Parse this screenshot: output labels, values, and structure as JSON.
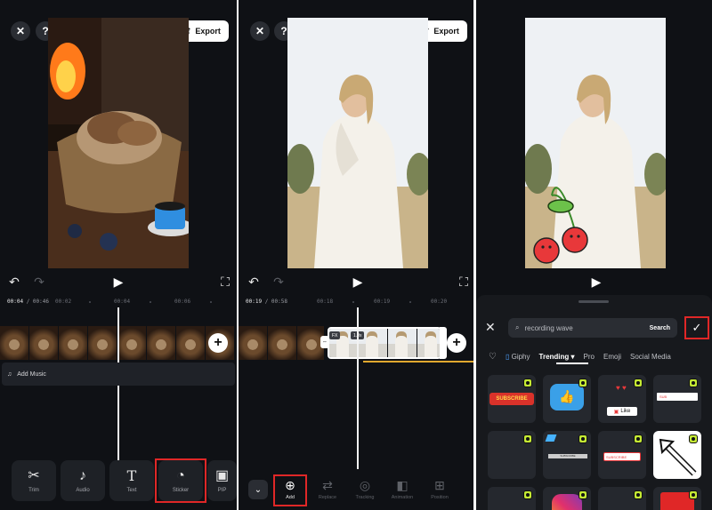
{
  "panel1": {
    "export_label": "Export",
    "time_current": "00:04",
    "time_total": "/ 00:46",
    "ticks": [
      "00:02",
      "00:04",
      "00:06"
    ],
    "music_label": "Add Music",
    "tools": [
      "Trim",
      "Audio",
      "Text",
      "Sticker",
      "PIP"
    ]
  },
  "panel2": {
    "export_label": "Export",
    "time_current": "00:19",
    "time_total": "/ 00:58",
    "ticks": [
      "00:18",
      "00:19",
      "00:20"
    ],
    "clip_tags": [
      "FX",
      "1.0x"
    ],
    "tools": [
      "Add",
      "Replace",
      "Tracking",
      "Animation",
      "Position"
    ]
  },
  "panel3": {
    "search_value": "recording wave",
    "search_button": "Search",
    "tabs": [
      "Giphy",
      "Trending",
      "Pro",
      "Emoji",
      "Social Media"
    ],
    "stickers": [
      {
        "text": "SUBSCRIBE"
      },
      {
        "text": ""
      },
      {
        "text": "Like"
      },
      {
        "text": "SUB"
      },
      {
        "text": ""
      },
      {
        "text": "SUBSCRIBE"
      },
      {
        "text": "SUBSCRIBE"
      },
      {
        "text": ""
      }
    ]
  },
  "colors": {
    "highlight": "#e02727",
    "badge": "#c5ea34",
    "background": "#0f1115"
  }
}
